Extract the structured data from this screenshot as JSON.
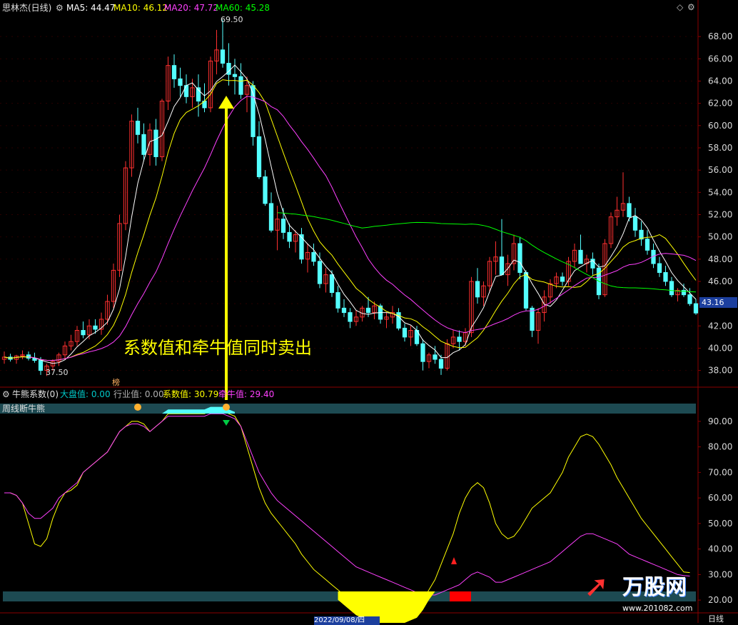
{
  "header": {
    "title": "思林杰(日线)",
    "ma": [
      {
        "label": "MA5: 44.47",
        "color": "#ffffff"
      },
      {
        "label": "MA10: 46.12",
        "color": "#ffff00"
      },
      {
        "label": "MA20: 47.72",
        "color": "#ff40ff"
      },
      {
        "label": "MA60: 45.28",
        "color": "#00ff00"
      }
    ]
  },
  "indicator_header": {
    "name": "牛熊系数(0)",
    "dapan": "大盘值: 0.00",
    "hangye": "行业值: 0.00",
    "xishu": "系数值: 30.79",
    "qianniu": "牵牛值: 29.40",
    "weekly_label": "周线断牛熊"
  },
  "annotation": {
    "text": "系数值和牵牛值同时卖出"
  },
  "price_labels": {
    "high": "69.50",
    "low": "37.50",
    "current": "43.16",
    "badge": "榜"
  },
  "footer": {
    "date": "2022/09/08/四",
    "period": "日线",
    "watermark_brand": "万股网",
    "watermark_url": "www.201082.com"
  },
  "colors": {
    "up": "#ff3030",
    "down": "#54ffff",
    "ma5": "#ffffff",
    "ma10": "#ffff00",
    "ma20": "#ff40ff",
    "ma60": "#00ff00",
    "grid": "#8a0000",
    "panel_bar": "#1d4a52"
  },
  "chart_data": [
    {
      "type": "candlestick",
      "title": "思林杰(日线)",
      "ylim": [
        36.5,
        70
      ],
      "y_ticks": [
        38.0,
        40.0,
        42.0,
        44.0,
        46.0,
        48.0,
        50.0,
        52.0,
        54.0,
        56.0,
        58.0,
        60.0,
        62.0,
        64.0,
        66.0,
        68.0
      ],
      "candles": [
        [
          39.0,
          39.7,
          38.6,
          39.2
        ],
        [
          39.2,
          39.5,
          38.8,
          39.0
        ],
        [
          39.0,
          39.4,
          38.6,
          39.3
        ],
        [
          39.3,
          39.8,
          39.0,
          39.4
        ],
        [
          39.4,
          39.7,
          38.9,
          39.1
        ],
        [
          39.1,
          39.6,
          38.7,
          38.9
        ],
        [
          38.9,
          39.2,
          37.6,
          38.0
        ],
        [
          38.0,
          38.6,
          37.5,
          38.4
        ],
        [
          38.4,
          39.0,
          38.0,
          38.8
        ],
        [
          38.8,
          39.6,
          38.4,
          39.4
        ],
        [
          39.4,
          40.6,
          39.0,
          40.2
        ],
        [
          40.2,
          41.2,
          39.8,
          40.6
        ],
        [
          40.6,
          42.0,
          40.2,
          41.6
        ],
        [
          41.6,
          42.4,
          40.9,
          41.2
        ],
        [
          41.2,
          42.6,
          40.8,
          42.0
        ],
        [
          42.0,
          42.6,
          41.3,
          41.7
        ],
        [
          41.7,
          43.2,
          41.2,
          42.6
        ],
        [
          42.6,
          44.8,
          42.1,
          44.2
        ],
        [
          44.2,
          47.6,
          43.6,
          47.0
        ],
        [
          47.0,
          52.0,
          46.4,
          51.2
        ],
        [
          51.2,
          56.8,
          50.6,
          56.2
        ],
        [
          56.2,
          61.0,
          55.4,
          60.4
        ],
        [
          60.4,
          61.6,
          58.4,
          59.2
        ],
        [
          59.2,
          60.2,
          56.8,
          57.4
        ],
        [
          57.4,
          60.2,
          56.4,
          59.6
        ],
        [
          59.6,
          60.6,
          56.4,
          57.2
        ],
        [
          57.2,
          62.4,
          56.8,
          62.2
        ],
        [
          62.2,
          66.2,
          61.4,
          65.4
        ],
        [
          65.4,
          66.4,
          63.4,
          64.2
        ],
        [
          64.2,
          65.2,
          62.6,
          63.6
        ],
        [
          63.6,
          64.6,
          62.0,
          62.6
        ],
        [
          62.6,
          64.2,
          61.6,
          63.4
        ],
        [
          63.4,
          64.6,
          60.8,
          62.2
        ],
        [
          62.2,
          63.8,
          61.2,
          61.6
        ],
        [
          61.6,
          66.2,
          61.2,
          65.8
        ],
        [
          65.8,
          68.6,
          64.6,
          66.8
        ],
        [
          66.8,
          69.5,
          65.2,
          65.6
        ],
        [
          65.6,
          67.4,
          63.6,
          64.6
        ],
        [
          64.6,
          66.0,
          62.8,
          64.4
        ],
        [
          64.4,
          65.6,
          62.4,
          62.8
        ],
        [
          62.8,
          64.4,
          61.2,
          63.6
        ],
        [
          63.6,
          64.0,
          58.2,
          59.0
        ],
        [
          59.0,
          60.4,
          55.2,
          55.4
        ],
        [
          55.4,
          56.0,
          52.8,
          53.0
        ],
        [
          53.0,
          54.0,
          50.4,
          50.6
        ],
        [
          50.6,
          52.8,
          48.8,
          51.6
        ],
        [
          51.6,
          52.6,
          49.8,
          50.4
        ],
        [
          50.4,
          51.2,
          49.0,
          49.6
        ],
        [
          49.6,
          50.6,
          48.6,
          50.2
        ],
        [
          50.2,
          50.8,
          47.6,
          48.0
        ],
        [
          48.0,
          49.4,
          46.8,
          48.6
        ],
        [
          48.6,
          49.4,
          47.4,
          47.8
        ],
        [
          47.8,
          48.6,
          45.4,
          45.8
        ],
        [
          45.8,
          47.2,
          45.0,
          46.6
        ],
        [
          46.6,
          47.0,
          44.6,
          45.0
        ],
        [
          45.0,
          45.6,
          43.2,
          43.6
        ],
        [
          43.6,
          44.4,
          42.8,
          43.2
        ],
        [
          43.2,
          43.6,
          41.8,
          42.4
        ],
        [
          42.4,
          43.4,
          42.0,
          42.8
        ],
        [
          42.8,
          43.8,
          42.4,
          43.6
        ],
        [
          43.6,
          44.6,
          42.8,
          43.2
        ],
        [
          43.2,
          44.2,
          42.6,
          43.8
        ],
        [
          43.8,
          44.0,
          42.2,
          42.6
        ],
        [
          42.6,
          43.2,
          41.8,
          42.8
        ],
        [
          42.8,
          43.8,
          42.2,
          43.2
        ],
        [
          43.2,
          43.6,
          41.6,
          41.8
        ],
        [
          41.8,
          42.2,
          40.6,
          41.0
        ],
        [
          41.0,
          42.0,
          40.2,
          41.6
        ],
        [
          41.6,
          42.0,
          40.2,
          40.4
        ],
        [
          40.4,
          40.8,
          38.0,
          38.8
        ],
        [
          38.8,
          39.6,
          38.2,
          39.4
        ],
        [
          39.4,
          40.2,
          38.6,
          39.0
        ],
        [
          39.0,
          39.4,
          37.6,
          38.2
        ],
        [
          38.2,
          40.8,
          38.0,
          40.4
        ],
        [
          40.4,
          41.6,
          40.0,
          41.0
        ],
        [
          41.0,
          41.6,
          39.8,
          40.6
        ],
        [
          40.6,
          41.8,
          40.2,
          41.4
        ],
        [
          41.4,
          46.4,
          41.0,
          46.0
        ],
        [
          46.0,
          47.2,
          44.0,
          44.6
        ],
        [
          44.6,
          46.0,
          43.8,
          45.6
        ],
        [
          45.6,
          48.2,
          45.0,
          47.8
        ],
        [
          47.8,
          49.6,
          46.6,
          48.2
        ],
        [
          48.2,
          51.6,
          47.2,
          46.6
        ],
        [
          46.6,
          48.4,
          45.6,
          47.6
        ],
        [
          47.6,
          50.2,
          47.0,
          49.4
        ],
        [
          49.4,
          50.0,
          46.2,
          46.8
        ],
        [
          46.8,
          47.0,
          43.4,
          43.6
        ],
        [
          43.6,
          43.8,
          41.0,
          41.6
        ],
        [
          41.6,
          43.6,
          40.4,
          43.2
        ],
        [
          43.2,
          45.2,
          42.4,
          44.6
        ],
        [
          44.6,
          46.2,
          44.0,
          45.8
        ],
        [
          45.8,
          46.8,
          45.4,
          46.4
        ],
        [
          46.4,
          46.8,
          45.6,
          46.0
        ],
        [
          46.0,
          48.2,
          45.6,
          47.8
        ],
        [
          47.8,
          49.4,
          47.2,
          48.8
        ],
        [
          48.8,
          50.2,
          48.0,
          47.6
        ],
        [
          47.6,
          48.4,
          46.8,
          48.0
        ],
        [
          48.0,
          48.6,
          46.6,
          47.2
        ],
        [
          47.2,
          47.6,
          44.4,
          44.8
        ],
        [
          44.8,
          49.8,
          44.6,
          49.4
        ],
        [
          49.4,
          52.2,
          49.0,
          51.8
        ],
        [
          51.8,
          53.6,
          51.0,
          52.4
        ],
        [
          52.4,
          55.8,
          51.8,
          53.0
        ],
        [
          53.0,
          53.6,
          51.4,
          51.8
        ],
        [
          51.8,
          52.6,
          50.0,
          50.6
        ],
        [
          50.6,
          51.4,
          49.2,
          49.8
        ],
        [
          49.8,
          50.6,
          48.4,
          48.8
        ],
        [
          48.8,
          49.4,
          47.2,
          47.6
        ],
        [
          47.6,
          48.2,
          46.4,
          46.8
        ],
        [
          46.8,
          47.4,
          45.6,
          46.0
        ],
        [
          46.0,
          46.4,
          44.6,
          44.8
        ],
        [
          44.8,
          45.4,
          44.2,
          45.2
        ],
        [
          45.2,
          45.8,
          44.6,
          44.8
        ],
        [
          44.8,
          45.4,
          43.8,
          44.0
        ],
        [
          44.0,
          44.4,
          43.0,
          43.16
        ]
      ],
      "ma_series": [
        {
          "name": "MA5",
          "value": 44.47
        },
        {
          "name": "MA10",
          "value": 46.12
        },
        {
          "name": "MA20",
          "value": 47.72
        },
        {
          "name": "MA60",
          "value": 45.28
        }
      ]
    },
    {
      "type": "line",
      "title": "牛熊系数(0)",
      "ylim": [
        15,
        95
      ],
      "y_ticks": [
        20.0,
        30.0,
        40.0,
        50.0,
        60.0,
        70.0,
        80.0,
        90.0
      ],
      "series": [
        {
          "name": "系数值",
          "color": "#ffff00",
          "values": [
            62,
            62,
            61,
            58,
            50,
            42,
            41,
            44,
            52,
            58,
            62,
            63,
            65,
            70,
            72,
            74,
            76,
            78,
            82,
            86,
            88,
            90,
            90,
            89,
            86,
            88,
            90,
            93,
            93,
            93,
            93,
            93,
            93,
            93,
            94,
            94,
            94,
            93,
            92,
            88,
            80,
            72,
            64,
            58,
            54,
            51,
            48,
            45,
            42,
            38,
            35,
            32,
            30,
            28,
            26,
            24,
            22,
            20,
            18,
            17,
            16,
            15,
            14,
            14,
            14,
            14,
            15,
            16,
            17,
            20,
            24,
            28,
            34,
            40,
            46,
            54,
            60,
            64,
            66,
            64,
            58,
            50,
            46,
            44,
            45,
            48,
            52,
            56,
            58,
            60,
            62,
            66,
            70,
            76,
            80,
            84,
            85,
            84,
            81,
            77,
            73,
            68,
            64,
            60,
            56,
            52,
            49,
            46,
            43,
            40,
            37,
            34,
            31,
            30.79
          ]
        },
        {
          "name": "牵牛值",
          "color": "#ff40ff",
          "values": [
            62,
            62,
            61,
            58,
            54,
            52,
            52,
            54,
            56,
            60,
            62,
            64,
            66,
            70,
            72,
            74,
            76,
            78,
            82,
            86,
            88,
            89,
            89,
            88,
            86,
            88,
            90,
            92,
            92,
            92,
            92,
            92,
            92,
            92,
            93,
            93,
            93,
            92,
            91,
            88,
            82,
            76,
            70,
            66,
            62,
            59,
            57,
            55,
            53,
            51,
            49,
            47,
            45,
            43,
            41,
            39,
            37,
            35,
            33,
            32,
            31,
            30,
            29,
            28,
            27,
            26,
            25,
            24,
            23,
            22,
            22,
            22,
            23,
            24,
            25,
            26,
            28,
            30,
            31,
            30,
            29,
            27,
            27,
            28,
            29,
            30,
            31,
            32,
            33,
            34,
            35,
            37,
            39,
            41,
            43,
            45,
            46,
            46,
            45,
            44,
            43,
            42,
            40,
            38,
            37,
            36,
            35,
            34,
            33,
            32,
            31,
            30,
            29.6,
            29.4
          ]
        }
      ]
    }
  ]
}
